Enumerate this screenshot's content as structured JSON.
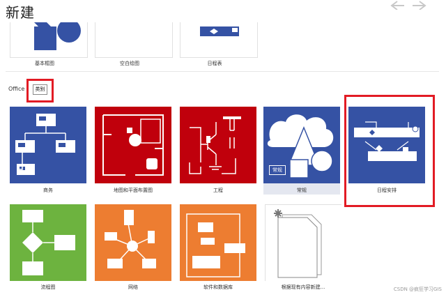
{
  "title": "新建",
  "top_templates": [
    {
      "label": "基本框图"
    },
    {
      "label": "空白绘图"
    },
    {
      "label": "日程表"
    }
  ],
  "section": {
    "name": "Office",
    "category_button": "类别"
  },
  "categories": [
    {
      "label": "商务",
      "color": "#3552a4"
    },
    {
      "label": "地图和平面布置图",
      "color": "#c0000c"
    },
    {
      "label": "工程",
      "color": "#c0000c"
    },
    {
      "label": "常规",
      "color": "#3552a4",
      "inner_label": "常规"
    },
    {
      "label": "日程安排",
      "color": "#3552a4"
    },
    {
      "label": "流程图",
      "color": "#6db33f"
    },
    {
      "label": "网络",
      "color": "#ed7d31"
    },
    {
      "label": "软件和数据库",
      "color": "#ed7d31"
    },
    {
      "label": "根据现有内容新建..."
    }
  ],
  "watermark": "CSDN @疯狂学习GIS",
  "highlight_color": "#e21b24"
}
